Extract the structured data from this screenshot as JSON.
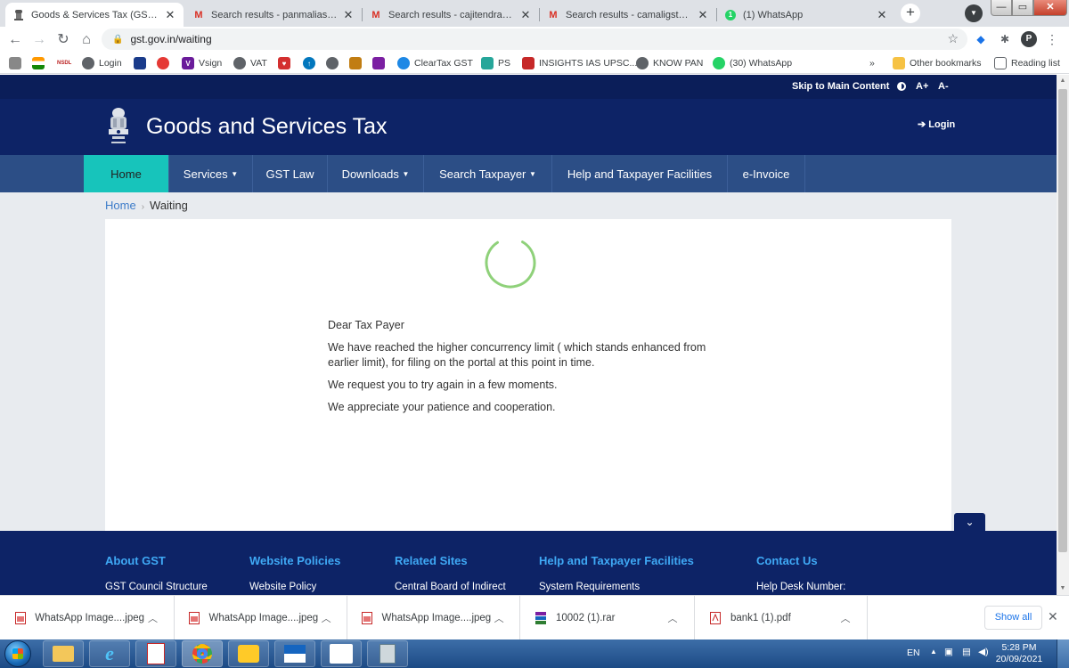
{
  "browser": {
    "tabs": [
      {
        "title": "Goods & Services Tax (GST) | We",
        "icon": "emblem-icon",
        "active": true
      },
      {
        "title": "Search results - panmaliassociate",
        "icon": "gmail-icon",
        "active": false
      },
      {
        "title": "Search results - cajitendramali@g",
        "icon": "gmail-icon",
        "active": false
      },
      {
        "title": "Search results - camaligst@gmai",
        "icon": "gmail-icon",
        "active": false
      },
      {
        "title": "(1) WhatsApp",
        "icon": "whatsapp-icon",
        "active": false
      }
    ],
    "url": "gst.gov.in/waiting",
    "profile_initial": "P",
    "bookmarks": [
      {
        "label": "",
        "icon": "emblem-icon"
      },
      {
        "label": "",
        "icon": "flag-icon"
      },
      {
        "label": "NSDL",
        "icon": ""
      },
      {
        "label": "Login",
        "icon": "globe-icon"
      },
      {
        "label": "",
        "icon": "bank-icon"
      },
      {
        "label": "",
        "icon": "wifi-icon"
      },
      {
        "label": "Vsign",
        "icon": "vsign-icon"
      },
      {
        "label": "VAT",
        "icon": "globe-icon"
      },
      {
        "label": "",
        "icon": "heart-icon"
      },
      {
        "label": "",
        "icon": "up-arrow-icon"
      },
      {
        "label": "",
        "icon": "globe-icon"
      },
      {
        "label": "",
        "icon": "shield-icon"
      },
      {
        "label": "",
        "icon": "chart-icon"
      },
      {
        "label": "ClearTax GST",
        "icon": "cleartax-icon"
      },
      {
        "label": "PS",
        "icon": "ps-icon"
      },
      {
        "label": "INSIGHTS IAS UPSC...",
        "icon": "insights-icon"
      },
      {
        "label": "KNOW PAN",
        "icon": "globe-icon"
      },
      {
        "label": "(30) WhatsApp",
        "icon": "whatsapp-icon"
      }
    ],
    "more_bookmarks": "»",
    "other_bookmarks": "Other bookmarks",
    "reading_list": "Reading list"
  },
  "site": {
    "skip_link": "Skip to Main Content",
    "font_increase": "A+",
    "font_decrease": "A-",
    "title": "Goods and Services Tax",
    "login": "Login",
    "nav": [
      {
        "label": "Home",
        "dropdown": false
      },
      {
        "label": "Services",
        "dropdown": true
      },
      {
        "label": "GST Law",
        "dropdown": false
      },
      {
        "label": "Downloads",
        "dropdown": true
      },
      {
        "label": "Search Taxpayer",
        "dropdown": true
      },
      {
        "label": "Help and Taxpayer Facilities",
        "dropdown": false
      },
      {
        "label": "e-Invoice",
        "dropdown": false
      }
    ],
    "breadcrumb": {
      "home": "Home",
      "separator": "›",
      "current": "Waiting"
    },
    "message": {
      "greeting": "Dear Tax Payer",
      "line1": "We have reached the higher concurrency limit ( which stands enhanced from earlier limit), for filing on the portal at this point in time.",
      "line2": "We request you to try again in a few moments.",
      "line3": "We appreciate your patience and cooperation."
    },
    "footer": [
      {
        "heading": "About GST",
        "first_link": "GST Council Structure"
      },
      {
        "heading": "Website Policies",
        "first_link": "Website Policy"
      },
      {
        "heading": "Related Sites",
        "first_link": "Central Board of Indirect"
      },
      {
        "heading": "Help and Taxpayer Facilities",
        "first_link": "System Requirements"
      },
      {
        "heading": "Contact Us",
        "first_link": "Help Desk Number:"
      }
    ]
  },
  "downloads": {
    "items": [
      {
        "name": "WhatsApp Image....jpeg",
        "type": "image"
      },
      {
        "name": "WhatsApp Image....jpeg",
        "type": "image"
      },
      {
        "name": "WhatsApp Image....jpeg",
        "type": "image"
      },
      {
        "name": "10002 (1).rar",
        "type": "archive"
      },
      {
        "name": "bank1 (1).pdf",
        "type": "pdf"
      }
    ],
    "show_all": "Show all"
  },
  "taskbar": {
    "language": "EN",
    "time": "5:28 PM",
    "date": "20/09/2021"
  },
  "colors": {
    "header_bg": "#0d2366",
    "nav_bg": "#2c4e86",
    "nav_active": "#17c4bb",
    "spinner": "#8fd17a",
    "footer_heading": "#3fa9f5"
  }
}
